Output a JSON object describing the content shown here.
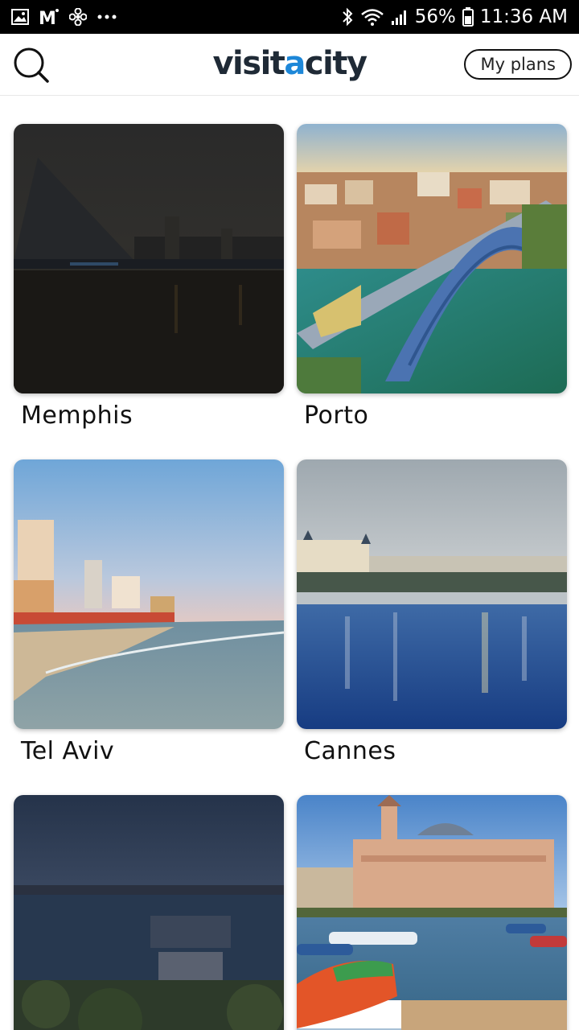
{
  "status_bar": {
    "battery": "56%",
    "time": "11:36 AM",
    "left_icons": [
      "image-icon",
      "gmail-icon",
      "fan-icon",
      "more-dots-icon"
    ],
    "right_icons": [
      "bluetooth-icon",
      "wifi-icon",
      "signal-icon",
      "battery-icon"
    ]
  },
  "header": {
    "logo_prefix": "visit",
    "logo_accent": "a",
    "logo_suffix": "city",
    "my_plans_label": "My plans",
    "search_icon": "search-icon"
  },
  "colors": {
    "logo_dark": "#1f2a36",
    "logo_accent": "#1d87d8",
    "status_bar": "#000000"
  },
  "cities": [
    {
      "name": "Memphis"
    },
    {
      "name": "Porto"
    },
    {
      "name": "Tel Aviv"
    },
    {
      "name": "Cannes"
    },
    {
      "name": ""
    },
    {
      "name": ""
    }
  ]
}
